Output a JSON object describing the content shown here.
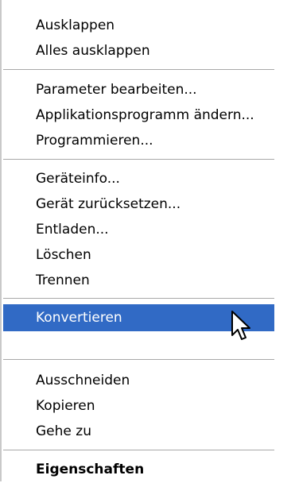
{
  "menu": {
    "items": [
      {
        "label": "Ausklappen"
      },
      {
        "label": "Alles ausklappen"
      },
      {
        "label": "Parameter bearbeiten..."
      },
      {
        "label": "Applikationsprogramm ändern..."
      },
      {
        "label": "Programmieren..."
      },
      {
        "label": "Geräteinfo..."
      },
      {
        "label": "Gerät zurücksetzen..."
      },
      {
        "label": "Entladen..."
      },
      {
        "label": "Löschen"
      },
      {
        "label": "Trennen"
      },
      {
        "label": "Konvertieren"
      },
      {
        "label": "Ausschneiden"
      },
      {
        "label": "Kopieren"
      },
      {
        "label": "Gehe zu"
      },
      {
        "label": "Eigenschaften"
      }
    ],
    "highlight_color": "#316ac5",
    "cursor_icon": "mouse-pointer-icon"
  }
}
